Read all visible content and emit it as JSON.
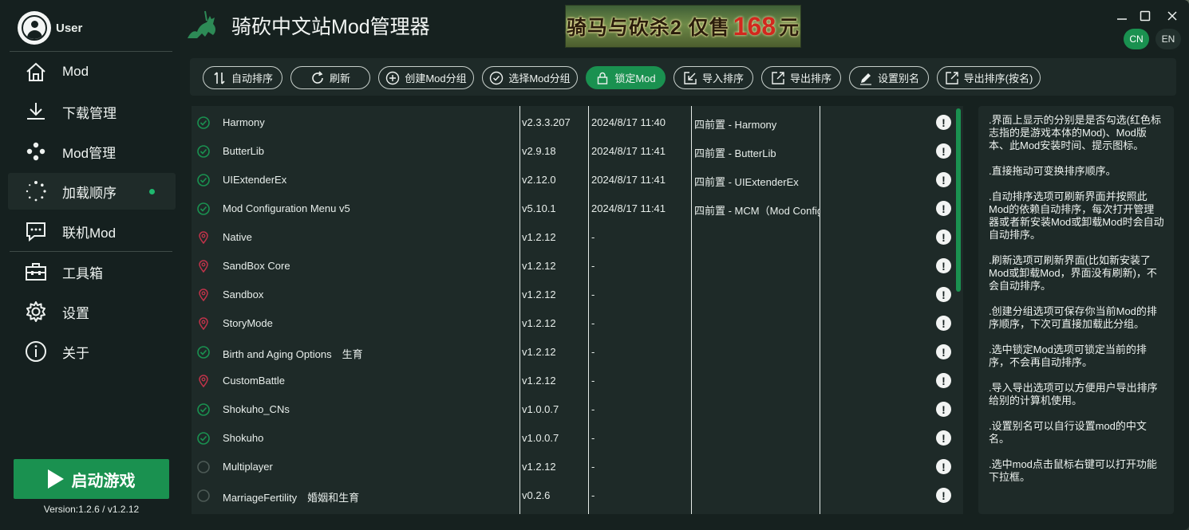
{
  "user": {
    "name": "User"
  },
  "app": {
    "title": "骑砍中文站Mod管理器"
  },
  "banner": {
    "prefix": "骑马与砍杀2 仅售",
    "price": "168",
    "suffix": "元"
  },
  "language": {
    "cn": "CN",
    "en": "EN",
    "selected": "CN"
  },
  "nav": {
    "items": [
      {
        "label": "Mod",
        "icon": "home-icon"
      },
      {
        "label": "下载管理",
        "icon": "download-icon"
      },
      {
        "label": "Mod管理",
        "icon": "dots-icon"
      },
      {
        "label": "加载顺序",
        "icon": "spinner-icon",
        "active": true
      },
      {
        "label": "联机Mod",
        "icon": "chat-icon"
      },
      {
        "label": "工具箱",
        "icon": "toolbox-icon"
      },
      {
        "label": "设置",
        "icon": "gear-icon"
      },
      {
        "label": "关于",
        "icon": "info-icon"
      }
    ]
  },
  "launch": {
    "label": "启动游戏"
  },
  "version": "Version:1.2.6 / v1.2.12",
  "toolbar": {
    "buttons": [
      {
        "label": "自动排序",
        "icon": "sort-icon"
      },
      {
        "label": "刷新",
        "icon": "refresh-icon"
      },
      {
        "label": "创建Mod分组",
        "icon": "plus-circle-icon"
      },
      {
        "label": "选择Mod分组",
        "icon": "check-circle-icon"
      },
      {
        "label": "锁定Mod",
        "icon": "lock-icon",
        "active": true
      },
      {
        "label": "导入排序",
        "icon": "import-icon"
      },
      {
        "label": "导出排序",
        "icon": "export-icon"
      },
      {
        "label": "设置别名",
        "icon": "pencil-icon"
      },
      {
        "label": "导出排序(按名)",
        "icon": "export-icon"
      }
    ]
  },
  "mods": [
    {
      "status": "checked",
      "name": "Harmony",
      "version": "v2.3.3.207",
      "date": "2024/8/17 11:40",
      "prereq": "四前置 - Harmony"
    },
    {
      "status": "checked",
      "name": "ButterLib",
      "version": "v2.9.18",
      "date": "2024/8/17 11:41",
      "prereq": "四前置 - ButterLib"
    },
    {
      "status": "checked",
      "name": "UIExtenderEx",
      "version": "v2.12.0",
      "date": "2024/8/17 11:41",
      "prereq": "四前置 - UIExtenderEx"
    },
    {
      "status": "checked",
      "name": "Mod Configuration Menu v5",
      "version": "v5.10.1",
      "date": "2024/8/17 11:41",
      "prereq": "四前置 - MCM（Mod Configuration Menu）"
    },
    {
      "status": "official",
      "name": "Native",
      "version": "v1.2.12",
      "date": "-",
      "prereq": ""
    },
    {
      "status": "official",
      "name": "SandBox Core",
      "version": "v1.2.12",
      "date": "-",
      "prereq": ""
    },
    {
      "status": "official",
      "name": "Sandbox",
      "version": "v1.2.12",
      "date": "-",
      "prereq": ""
    },
    {
      "status": "official",
      "name": "StoryMode",
      "version": "v1.2.12",
      "date": "-",
      "prereq": ""
    },
    {
      "status": "checked",
      "name": "Birth and Aging Options　生育",
      "version": "v1.2.12",
      "date": "-",
      "prereq": ""
    },
    {
      "status": "official",
      "name": "CustomBattle",
      "version": "v1.2.12",
      "date": "-",
      "prereq": ""
    },
    {
      "status": "checked",
      "name": "Shokuho_CNs",
      "version": "v1.0.0.7",
      "date": "-",
      "prereq": ""
    },
    {
      "status": "checked",
      "name": "Shokuho",
      "version": "v1.0.0.7",
      "date": "-",
      "prereq": ""
    },
    {
      "status": "unchecked",
      "name": "Multiplayer",
      "version": "v1.2.12",
      "date": "-",
      "prereq": ""
    },
    {
      "status": "unchecked",
      "name": "MarriageFertility　婚姻和生育",
      "version": "v0.2.6",
      "date": "-",
      "prereq": ""
    }
  ],
  "info": [
    ".界面上显示的分别是是否勾选(红色标志指的是游戏本体的Mod)、Mod版本、此Mod安装时间、提示图标。",
    ".直接拖动可变换排序顺序。",
    ".自动排序选项可刷新界面并按照此Mod的依赖自动排序，每次打开管理器或者新安装Mod或卸载Mod时会自动自动排序。",
    ".刷新选项可刷新界面(比如新安装了Mod或卸载Mod，界面没有刷新)，不会自动排序。",
    ".创建分组选项可保存你当前Mod的排序顺序，下次可直接加载此分组。",
    ".选中锁定Mod选项可锁定当前的排序，不会再自动排序。",
    ".导入导出选项可以方便用户导出排序给别的计算机使用。",
    ".设置别名可以自行设置mod的中文名。",
    ".选中mod点击鼠标右键可以打开功能下拉框。"
  ],
  "colors": {
    "accent": "#1a9150",
    "official_marker": "#c0334a",
    "background": "#16211f"
  }
}
